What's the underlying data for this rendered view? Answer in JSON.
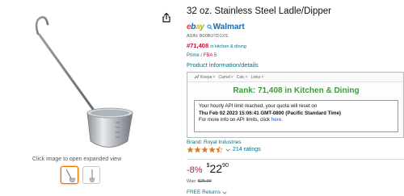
{
  "product": {
    "title": "32 oz. Stainless Steel Ladle/Dipper",
    "image_caption": "Click image to open expanded view",
    "asin_line": "ASIN: B00BUTD1XS",
    "rank_number": "#71,408",
    "rank_category": "in kitchen & dining",
    "prime_label": "Prime",
    "fba_label": "FBA 5",
    "product_info_link": "Product information/details",
    "brand_line": "Brand: Royal Industries",
    "rating": 4.5,
    "ratings_count": "214 ratings",
    "discount": "-8%",
    "price_symbol": "$",
    "price_whole": "22",
    "price_fraction": "90",
    "was_label": "Was:",
    "was_price": "$25.00",
    "returns_label": "FREE Returns"
  },
  "compare": {
    "ebay_letters": [
      "e",
      "b",
      "a",
      "y"
    ],
    "walmart_label": "Walmart"
  },
  "keepa": {
    "tabs": [
      "Keepa",
      "Camel",
      "Calc",
      "Links"
    ],
    "rank_text": "Rank:  71,408 in Kitchen & Dining",
    "api_line1": "Your hourly API limit reached, your quota will reset on",
    "api_line2": "Thu Feb 02 2023 15:06:41 GMT-0800 (Pacific Standard Time)",
    "api_line3_prefix": "For more info on API limits, click ",
    "api_line3_link": "here",
    "api_line3_suffix": "."
  },
  "icons": {
    "share": "share-icon",
    "star": "star-icon",
    "chevron": "chevron-down-icon"
  },
  "colors": {
    "link": "#007185",
    "deal_red": "#cc0c39",
    "keepa_green": "#3c9b3c",
    "star": "#de7921",
    "walmart_blue": "#0071ce",
    "thumb_selected": "#e77600"
  }
}
